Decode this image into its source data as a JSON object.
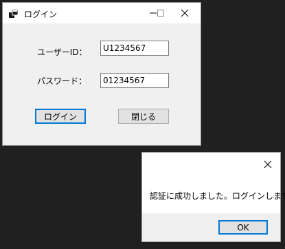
{
  "login_window": {
    "title": "ログイン",
    "app_icon": "app-icon",
    "titlebar_buttons": [
      "minimize-icon",
      "maximize-icon",
      "close-icon"
    ],
    "user_id_label": "ユーザーID：",
    "user_id_value": "U1234567",
    "password_label": "パスワード：",
    "password_value": "01234567",
    "login_button": "ログイン",
    "close_button": "閉じる"
  },
  "dialog": {
    "message": "認証に成功しました。ログインします。",
    "ok_button": "OK",
    "close_icon": "close-icon"
  },
  "colors": {
    "accent": "#0078d7",
    "window_bg": "#f0f0f0",
    "desktop_bg": "#202020"
  }
}
